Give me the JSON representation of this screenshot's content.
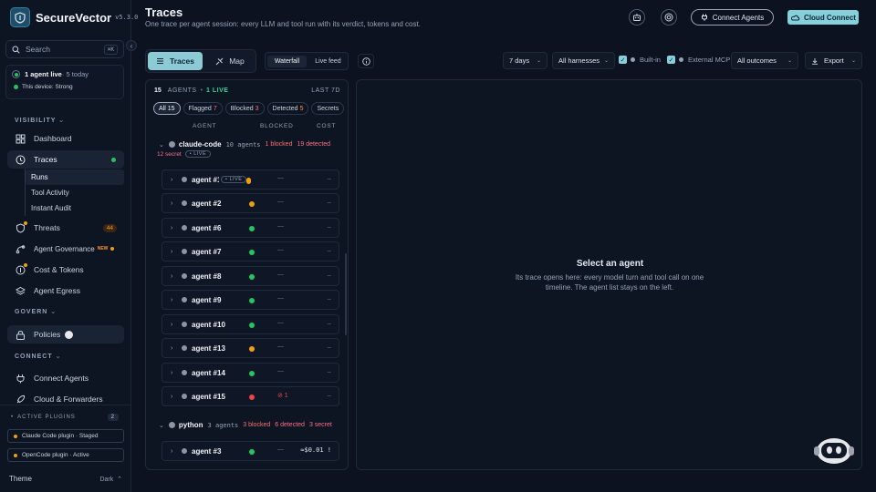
{
  "brand": {
    "name": "SecureVector",
    "version": "v5.3.0"
  },
  "search": {
    "placeholder": "Search",
    "shortcut": "⌘K"
  },
  "status": {
    "agent_live": "1 agent live",
    "today": " · 5 today",
    "device": "This device: Strong"
  },
  "nav": {
    "visibility_label": "VISIBILITY",
    "dashboard": "Dashboard",
    "traces": "Traces",
    "traces_sub": [
      "Runs",
      "Tool Activity",
      "Instant Audit"
    ],
    "threats": "Threats",
    "threats_count": "44",
    "agent_governance": "Agent Governance",
    "new_tag": "NEW",
    "cost_tokens": "Cost & Tokens",
    "agent_egress": "Agent Egress",
    "govern_label": "GOVERN",
    "policies": "Policies",
    "connect_label": "CONNECT",
    "connect_agents": "Connect Agents",
    "cloud_forwarders": "Cloud & Forwarders"
  },
  "plugins": {
    "heading": "ACTIVE PLUGINS",
    "count": "2",
    "items": [
      "Claude Code plugin · Staged",
      "OpenCode plugin · Active"
    ]
  },
  "theme": {
    "label": "Theme",
    "value": "Dark"
  },
  "header": {
    "title": "Traces",
    "subtitle": "One trace per agent session: every LLM and tool run with its verdict, tokens and cost.",
    "connect_agents": "Connect Agents",
    "cloud_connect": "Cloud Connect"
  },
  "toolbar": {
    "tabs": [
      "Traces",
      "Map"
    ],
    "views": [
      "Waterfall",
      "Live feed"
    ],
    "range": "7 days",
    "harness": "All harnesses",
    "builtin": "Built-in",
    "external": "External MCP",
    "outcomes": "All outcomes",
    "export": "Export"
  },
  "list": {
    "count": "15",
    "agents_label": "AGENTS",
    "live": "1 LIVE",
    "range": "LAST 7D",
    "chips": [
      {
        "label": "All 15"
      },
      {
        "label": "Flagged",
        "num": "7"
      },
      {
        "label": "Blocked",
        "num": "3"
      },
      {
        "label": "Detected",
        "num": "5"
      },
      {
        "label": "Secrets"
      }
    ],
    "columns": [
      "AGENT",
      "BLOCKED",
      "COST"
    ],
    "groups": [
      {
        "name": "claude-code",
        "agents": "10 agents",
        "blocked": "1 blocked",
        "detected": "19 detected",
        "secret": "12 secret",
        "live": "LIVE"
      },
      {
        "name": "python",
        "agents": "3 agents",
        "blocked": "3 blocked",
        "detected": "6 detected",
        "secret": "3 secret"
      }
    ],
    "agents": [
      {
        "name": "agent #1",
        "status": "orange",
        "blocked": "—",
        "cost": "—",
        "live": "LIVE"
      },
      {
        "name": "agent #2",
        "status": "orange",
        "blocked": "—",
        "cost": "—"
      },
      {
        "name": "agent #6",
        "status": "green",
        "blocked": "—",
        "cost": "—"
      },
      {
        "name": "agent #7",
        "status": "green",
        "blocked": "—",
        "cost": "—"
      },
      {
        "name": "agent #8",
        "status": "green",
        "blocked": "—",
        "cost": "—"
      },
      {
        "name": "agent #9",
        "status": "green",
        "blocked": "—",
        "cost": "—"
      },
      {
        "name": "agent #10",
        "status": "green",
        "blocked": "—",
        "cost": "—"
      },
      {
        "name": "agent #13",
        "status": "orange",
        "blocked": "—",
        "cost": "—"
      },
      {
        "name": "agent #14",
        "status": "green",
        "blocked": "—",
        "cost": "—"
      },
      {
        "name": "agent #15",
        "status": "red",
        "blocked": "⊘ 1",
        "cost": "—"
      },
      {
        "name": "agent #3",
        "status": "green",
        "blocked": "—",
        "cost": "≈$0.01 !"
      }
    ]
  },
  "detail": {
    "title": "Select an agent",
    "text": "Its trace opens here: every model turn and tool call on one timeline. The agent list stays on the left."
  },
  "colors": {
    "accent": "#86d0dc",
    "green": "#22c55e",
    "orange": "#f59e0b",
    "red": "#ef4444"
  }
}
